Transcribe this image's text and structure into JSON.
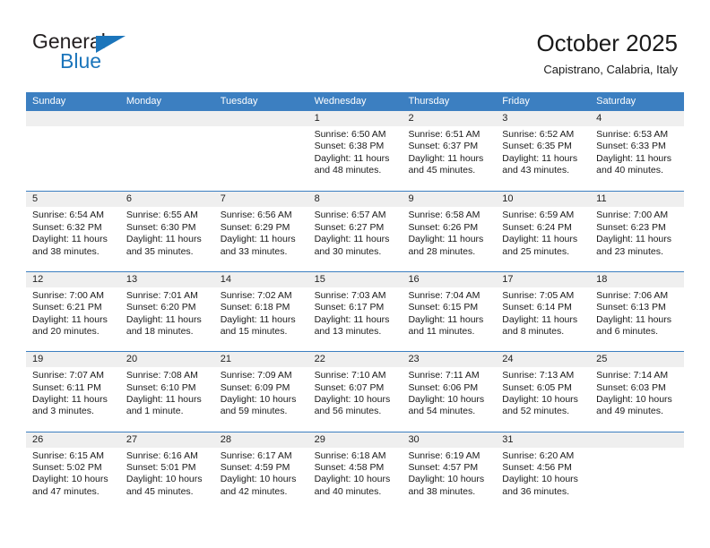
{
  "brand": {
    "name_part1": "General",
    "name_part2": "Blue",
    "accent_color": "#1b75bb"
  },
  "header": {
    "title": "October 2025",
    "subtitle": "Capistrano, Calabria, Italy"
  },
  "calendar": {
    "header_color": "#3c7fc1",
    "band_color": "#efefef",
    "weekdays": [
      "Sunday",
      "Monday",
      "Tuesday",
      "Wednesday",
      "Thursday",
      "Friday",
      "Saturday"
    ],
    "weeks": [
      [
        {
          "date": "",
          "lines": []
        },
        {
          "date": "",
          "lines": []
        },
        {
          "date": "",
          "lines": []
        },
        {
          "date": "1",
          "lines": [
            "Sunrise: 6:50 AM",
            "Sunset: 6:38 PM",
            "Daylight: 11 hours",
            "and 48 minutes."
          ]
        },
        {
          "date": "2",
          "lines": [
            "Sunrise: 6:51 AM",
            "Sunset: 6:37 PM",
            "Daylight: 11 hours",
            "and 45 minutes."
          ]
        },
        {
          "date": "3",
          "lines": [
            "Sunrise: 6:52 AM",
            "Sunset: 6:35 PM",
            "Daylight: 11 hours",
            "and 43 minutes."
          ]
        },
        {
          "date": "4",
          "lines": [
            "Sunrise: 6:53 AM",
            "Sunset: 6:33 PM",
            "Daylight: 11 hours",
            "and 40 minutes."
          ]
        }
      ],
      [
        {
          "date": "5",
          "lines": [
            "Sunrise: 6:54 AM",
            "Sunset: 6:32 PM",
            "Daylight: 11 hours",
            "and 38 minutes."
          ]
        },
        {
          "date": "6",
          "lines": [
            "Sunrise: 6:55 AM",
            "Sunset: 6:30 PM",
            "Daylight: 11 hours",
            "and 35 minutes."
          ]
        },
        {
          "date": "7",
          "lines": [
            "Sunrise: 6:56 AM",
            "Sunset: 6:29 PM",
            "Daylight: 11 hours",
            "and 33 minutes."
          ]
        },
        {
          "date": "8",
          "lines": [
            "Sunrise: 6:57 AM",
            "Sunset: 6:27 PM",
            "Daylight: 11 hours",
            "and 30 minutes."
          ]
        },
        {
          "date": "9",
          "lines": [
            "Sunrise: 6:58 AM",
            "Sunset: 6:26 PM",
            "Daylight: 11 hours",
            "and 28 minutes."
          ]
        },
        {
          "date": "10",
          "lines": [
            "Sunrise: 6:59 AM",
            "Sunset: 6:24 PM",
            "Daylight: 11 hours",
            "and 25 minutes."
          ]
        },
        {
          "date": "11",
          "lines": [
            "Sunrise: 7:00 AM",
            "Sunset: 6:23 PM",
            "Daylight: 11 hours",
            "and 23 minutes."
          ]
        }
      ],
      [
        {
          "date": "12",
          "lines": [
            "Sunrise: 7:00 AM",
            "Sunset: 6:21 PM",
            "Daylight: 11 hours",
            "and 20 minutes."
          ]
        },
        {
          "date": "13",
          "lines": [
            "Sunrise: 7:01 AM",
            "Sunset: 6:20 PM",
            "Daylight: 11 hours",
            "and 18 minutes."
          ]
        },
        {
          "date": "14",
          "lines": [
            "Sunrise: 7:02 AM",
            "Sunset: 6:18 PM",
            "Daylight: 11 hours",
            "and 15 minutes."
          ]
        },
        {
          "date": "15",
          "lines": [
            "Sunrise: 7:03 AM",
            "Sunset: 6:17 PM",
            "Daylight: 11 hours",
            "and 13 minutes."
          ]
        },
        {
          "date": "16",
          "lines": [
            "Sunrise: 7:04 AM",
            "Sunset: 6:15 PM",
            "Daylight: 11 hours",
            "and 11 minutes."
          ]
        },
        {
          "date": "17",
          "lines": [
            "Sunrise: 7:05 AM",
            "Sunset: 6:14 PM",
            "Daylight: 11 hours",
            "and 8 minutes."
          ]
        },
        {
          "date": "18",
          "lines": [
            "Sunrise: 7:06 AM",
            "Sunset: 6:13 PM",
            "Daylight: 11 hours",
            "and 6 minutes."
          ]
        }
      ],
      [
        {
          "date": "19",
          "lines": [
            "Sunrise: 7:07 AM",
            "Sunset: 6:11 PM",
            "Daylight: 11 hours",
            "and 3 minutes."
          ]
        },
        {
          "date": "20",
          "lines": [
            "Sunrise: 7:08 AM",
            "Sunset: 6:10 PM",
            "Daylight: 11 hours",
            "and 1 minute."
          ]
        },
        {
          "date": "21",
          "lines": [
            "Sunrise: 7:09 AM",
            "Sunset: 6:09 PM",
            "Daylight: 10 hours",
            "and 59 minutes."
          ]
        },
        {
          "date": "22",
          "lines": [
            "Sunrise: 7:10 AM",
            "Sunset: 6:07 PM",
            "Daylight: 10 hours",
            "and 56 minutes."
          ]
        },
        {
          "date": "23",
          "lines": [
            "Sunrise: 7:11 AM",
            "Sunset: 6:06 PM",
            "Daylight: 10 hours",
            "and 54 minutes."
          ]
        },
        {
          "date": "24",
          "lines": [
            "Sunrise: 7:13 AM",
            "Sunset: 6:05 PM",
            "Daylight: 10 hours",
            "and 52 minutes."
          ]
        },
        {
          "date": "25",
          "lines": [
            "Sunrise: 7:14 AM",
            "Sunset: 6:03 PM",
            "Daylight: 10 hours",
            "and 49 minutes."
          ]
        }
      ],
      [
        {
          "date": "26",
          "lines": [
            "Sunrise: 6:15 AM",
            "Sunset: 5:02 PM",
            "Daylight: 10 hours",
            "and 47 minutes."
          ]
        },
        {
          "date": "27",
          "lines": [
            "Sunrise: 6:16 AM",
            "Sunset: 5:01 PM",
            "Daylight: 10 hours",
            "and 45 minutes."
          ]
        },
        {
          "date": "28",
          "lines": [
            "Sunrise: 6:17 AM",
            "Sunset: 4:59 PM",
            "Daylight: 10 hours",
            "and 42 minutes."
          ]
        },
        {
          "date": "29",
          "lines": [
            "Sunrise: 6:18 AM",
            "Sunset: 4:58 PM",
            "Daylight: 10 hours",
            "and 40 minutes."
          ]
        },
        {
          "date": "30",
          "lines": [
            "Sunrise: 6:19 AM",
            "Sunset: 4:57 PM",
            "Daylight: 10 hours",
            "and 38 minutes."
          ]
        },
        {
          "date": "31",
          "lines": [
            "Sunrise: 6:20 AM",
            "Sunset: 4:56 PM",
            "Daylight: 10 hours",
            "and 36 minutes."
          ]
        },
        {
          "date": "",
          "lines": []
        }
      ]
    ]
  }
}
